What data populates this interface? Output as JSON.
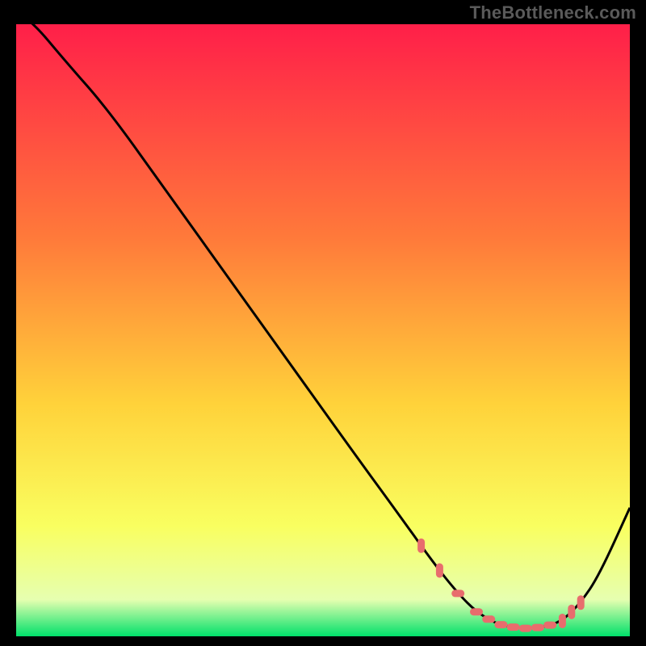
{
  "watermark": "TheBottleneck.com",
  "palette": {
    "frame_bg": "#000000",
    "curve": "#000000",
    "dots": "#e86d6d",
    "gradient_top": "#ff1f49",
    "gradient_mid1": "#ff7a3a",
    "gradient_mid2": "#ffd23a",
    "gradient_mid3": "#f9ff60",
    "gradient_mid4": "#e6ffb0",
    "gradient_bottom": "#00e06a"
  },
  "chart_data": {
    "type": "line",
    "title": "",
    "xlabel": "",
    "ylabel": "",
    "xlim": [
      0,
      100
    ],
    "ylim": [
      0,
      100
    ],
    "x": [
      0,
      3,
      8,
      15,
      25,
      35,
      45,
      55,
      63,
      68,
      72,
      75,
      78,
      80,
      83,
      86,
      89,
      92,
      95,
      100
    ],
    "values": [
      102,
      100,
      94,
      86,
      72,
      58,
      44,
      30,
      19,
      12,
      7,
      4,
      2.2,
      1.6,
      1.3,
      1.5,
      2.5,
      5.5,
      10,
      21
    ],
    "annotations": {
      "dotted_x": [
        66,
        69,
        72,
        75,
        77,
        79,
        81,
        83,
        85,
        87,
        89,
        90.5,
        92
      ],
      "dotted_y_on_curve": true
    }
  }
}
